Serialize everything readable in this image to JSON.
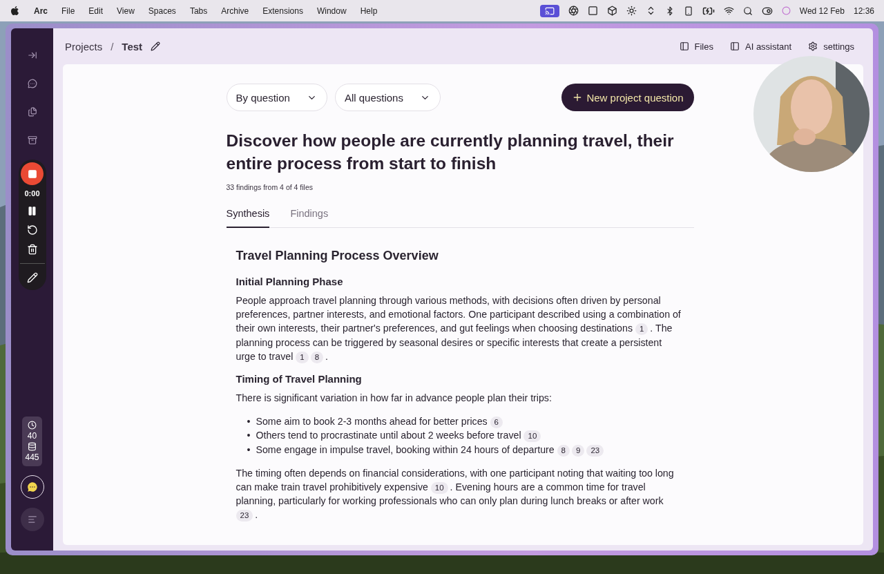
{
  "menubar": {
    "app": "Arc",
    "menus": [
      "File",
      "Edit",
      "View",
      "Spaces",
      "Tabs",
      "Archive",
      "Extensions",
      "Window",
      "Help"
    ],
    "date": "Wed 12 Feb",
    "time": "12:36"
  },
  "breadcrumb": [
    {
      "label": "Projects"
    },
    {
      "label": "Test"
    }
  ],
  "breadcrumb_separator": "/",
  "header_actions": [
    {
      "kind": "panel",
      "label": "Files"
    },
    {
      "kind": "panel",
      "label": "AI assistant"
    },
    {
      "kind": "settings",
      "label": "settings"
    }
  ],
  "recorder": {
    "time": "0:00"
  },
  "stats": [
    {
      "kind": "clock",
      "value": "40"
    },
    {
      "kind": "database",
      "value": "445"
    }
  ],
  "filters": [
    "By question",
    "All questions"
  ],
  "new_button": "New project question",
  "question": "Discover how people are currently planning travel, their entire process from start to finish",
  "meta": "33 findings from 4 of 4 files",
  "tabs": [
    {
      "label": "Synthesis",
      "selected": true
    },
    {
      "label": "Findings",
      "selected": false
    }
  ],
  "synthesis": {
    "title": "Travel Planning Process Overview",
    "blocks": [
      {
        "kind": "heading",
        "text": "Initial Planning Phase"
      },
      {
        "kind": "paragraph",
        "parts": [
          {
            "kind": "text",
            "text": "People approach travel planning through various methods, with decisions often driven by personal preferences, partner interests, and emotional factors. One participant described using a combination of their own interests, their partner's preferences, and gut feelings when choosing destinations "
          },
          {
            "kind": "cite",
            "text": "1"
          },
          {
            "kind": "text",
            "text": ". The planning process can be triggered by seasonal desires or specific interests that create a persistent urge to travel "
          },
          {
            "kind": "cite",
            "text": "1"
          },
          {
            "kind": "cite",
            "text": "8"
          },
          {
            "kind": "text",
            "text": "."
          }
        ]
      },
      {
        "kind": "heading",
        "text": "Timing of Travel Planning"
      },
      {
        "kind": "paragraph",
        "parts": [
          {
            "kind": "text",
            "text": "There is significant variation in how far in advance people plan their trips:"
          }
        ]
      },
      {
        "kind": "list",
        "items": [
          {
            "marker": "•",
            "parts": [
              {
                "kind": "text",
                "text": "Some aim to book 2-3 months ahead for better prices "
              },
              {
                "kind": "cite",
                "text": "6"
              }
            ]
          },
          {
            "marker": "•",
            "parts": [
              {
                "kind": "text",
                "text": "Others tend to procrastinate until about 2 weeks before travel "
              },
              {
                "kind": "cite",
                "text": "10"
              }
            ]
          },
          {
            "marker": "•",
            "parts": [
              {
                "kind": "text",
                "text": "Some engage in impulse travel, booking within 24 hours of departure "
              },
              {
                "kind": "cite",
                "text": "8"
              },
              {
                "kind": "cite",
                "text": "9"
              },
              {
                "kind": "cite",
                "text": "23"
              }
            ]
          }
        ]
      },
      {
        "kind": "paragraph",
        "parts": [
          {
            "kind": "text",
            "text": "The timing often depends on financial considerations, with one participant noting that waiting too long can make train travel prohibitively expensive "
          },
          {
            "kind": "cite",
            "text": "10"
          },
          {
            "kind": "text",
            "text": ". Evening hours are a common time for travel planning, particularly for working professionals who can only plan during lunch breaks or after work "
          },
          {
            "kind": "cite",
            "text": "23"
          },
          {
            "kind": "text",
            "text": "."
          }
        ]
      }
    ]
  },
  "webcam": {
    "kind": "picture"
  }
}
